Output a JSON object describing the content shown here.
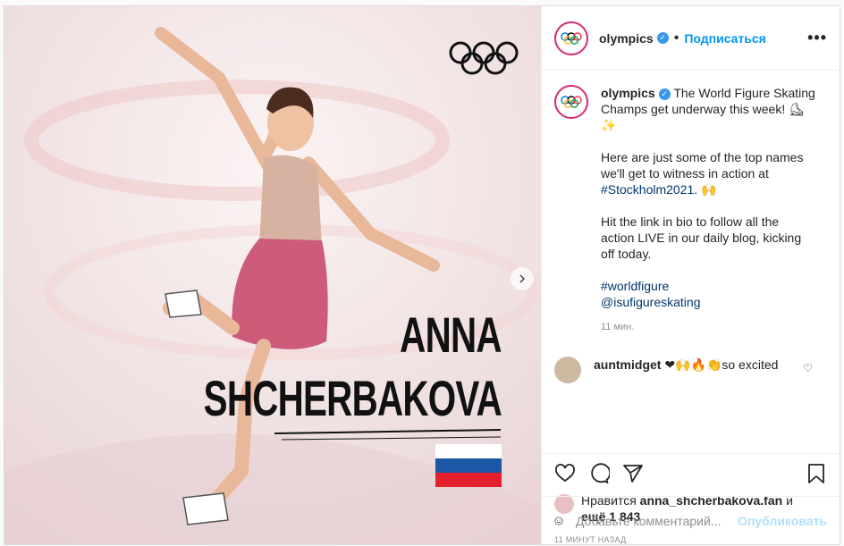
{
  "post": {
    "username": "olympics",
    "follow_label": "Подписаться",
    "dot": "•",
    "more": "•••",
    "image": {
      "athlete_line1": "ANNA",
      "athlete_line2": "SHCHERBAKOVA",
      "flag": "russia-flag",
      "logo": "olympic-rings"
    },
    "caption": {
      "username": "olympics",
      "text1": "The World Figure Skating Champs get underway this week! ⛸ ✨",
      "text2": "Here are just some of the top names we'll get to witness in action at",
      "hashtag1": "#Stockholm2021",
      "text2_end": ". 🙌",
      "text3": "Hit the link in bio to follow all the action LIVE in our daily blog, kicking off today.",
      "hashtag2": "#worldfigure",
      "mention": "@isufigureskating",
      "time": "11 мин."
    },
    "comment": {
      "username": "auntmidget",
      "text": "❤🙌🔥👏so excited"
    },
    "likes": {
      "prefix": "Нравится",
      "user": "anna_shcherbakova.fan",
      "mid": "и",
      "others": "ещё 1 843"
    },
    "timestamp": "11 МИНУТ НАЗАД",
    "add_comment": {
      "placeholder": "Добавьте комментарий...",
      "post_label": "Опубликовать"
    },
    "colors": {
      "accent": "#0095f6",
      "disabled_post": "#b2dffc",
      "ring_gradient": "#d62976",
      "flag_white": "#ffffff",
      "flag_blue": "#1c57a5",
      "flag_red": "#e4202c"
    }
  }
}
